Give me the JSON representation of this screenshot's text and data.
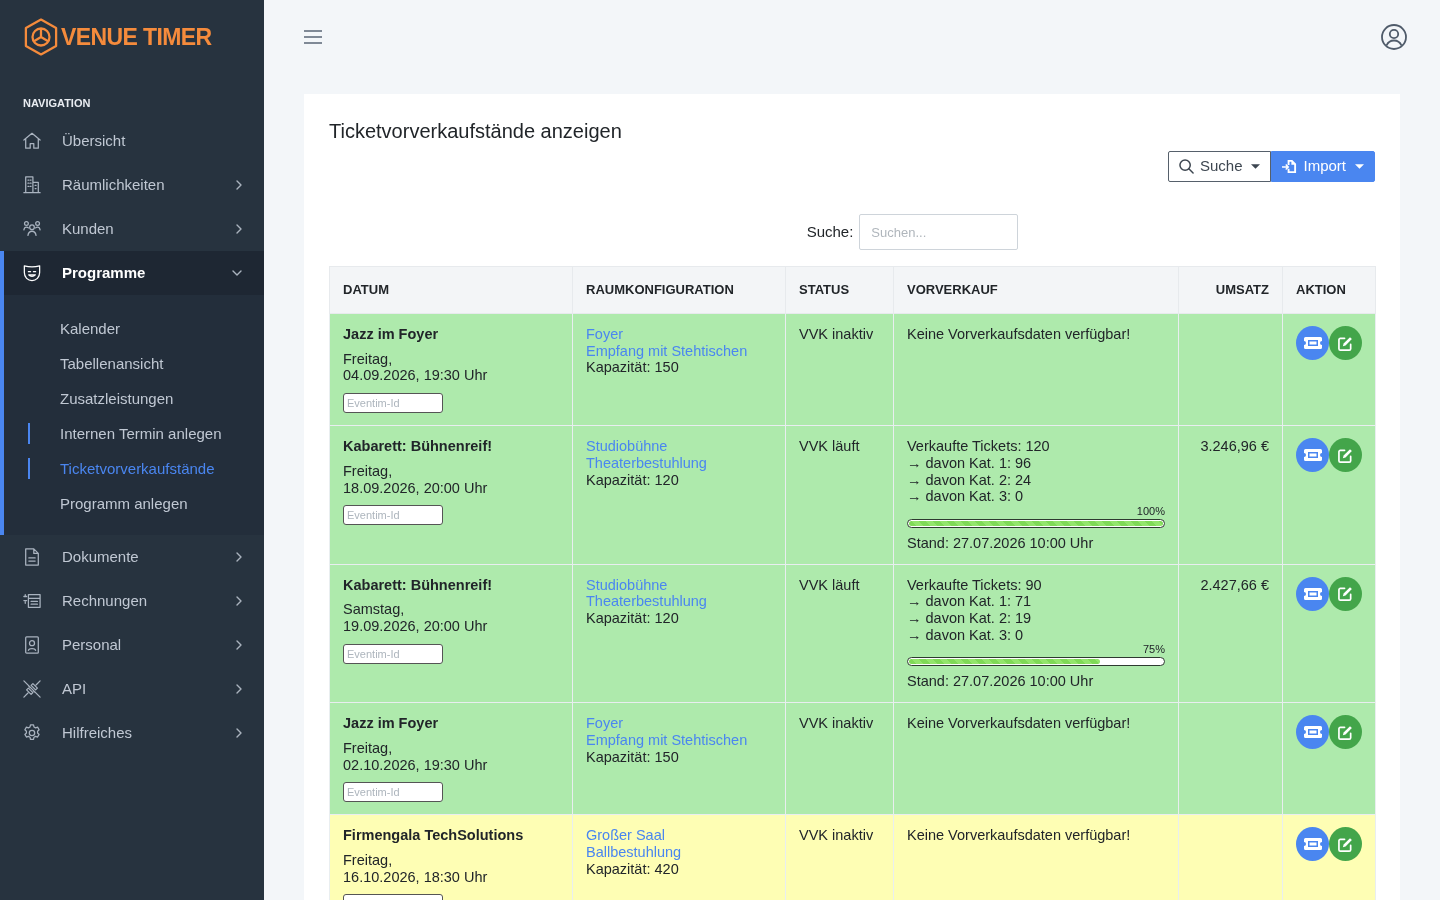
{
  "logo": {
    "text": "VENUE TIMER"
  },
  "sidebar": {
    "heading": "NAVIGATION",
    "items": [
      {
        "kind": "link",
        "label": "Übersicht"
      },
      {
        "kind": "group",
        "label": "Räumlichkeiten",
        "expanded": false
      },
      {
        "kind": "group",
        "label": "Kunden",
        "expanded": false
      },
      {
        "kind": "group",
        "label": "Programme",
        "expanded": true,
        "children": [
          {
            "label": "Kalender",
            "selected": false,
            "hovered": false
          },
          {
            "label": "Tabellenansicht",
            "selected": false,
            "hovered": false
          },
          {
            "label": "Zusatzleistungen",
            "selected": false,
            "hovered": false
          },
          {
            "label": "Internen Termin anlegen",
            "selected": false,
            "hovered": true
          },
          {
            "label": "Ticketvorverkaufstände",
            "selected": true,
            "hovered": false
          },
          {
            "label": "Programm anlegen",
            "selected": false,
            "hovered": false
          }
        ]
      },
      {
        "kind": "group",
        "label": "Dokumente",
        "expanded": false
      },
      {
        "kind": "group",
        "label": "Rechnungen",
        "expanded": false
      },
      {
        "kind": "group",
        "label": "Personal",
        "expanded": false
      },
      {
        "kind": "group",
        "label": "API",
        "expanded": false
      },
      {
        "kind": "group",
        "label": "Hilfreiches",
        "expanded": false
      }
    ]
  },
  "page": {
    "title": "Ticketvorverkaufstände anzeigen",
    "buttons": [
      {
        "kind": "outline",
        "label": "Suche"
      },
      {
        "kind": "primary",
        "label": "Import"
      }
    ],
    "search": {
      "label": "Suche:",
      "placeholder": "Suchen..."
    }
  },
  "table": {
    "columns": [
      "DATUM",
      "RAUMKONFIGURATION",
      "STATUS",
      "VORVERKAUF",
      "UMSATZ",
      "AKTION"
    ],
    "rows": [
      {
        "color": "#aeeaac",
        "title": "Jazz im Foyer",
        "weekday": "Freitag,",
        "datetime": "04.09.2026, 19:30 Uhr",
        "eventim_placeholder": "Eventim-Id",
        "venue": "Foyer",
        "setup": "Empfang mit Stehtischen",
        "capacity": "Kapazität: 150",
        "status": "VVK inaktiv",
        "presale": {
          "kind": "none",
          "text": "Keine Vorverkaufsdaten verfügbar!"
        }
      },
      {
        "color": "#aeeaac",
        "title": "Kabarett: Bühnenreif!",
        "weekday": "Freitag,",
        "datetime": "18.09.2026, 20:00 Uhr",
        "eventim_placeholder": "Eventim-Id",
        "venue": "Studiobühne",
        "setup": "Theaterbestuhlung",
        "capacity": "Kapazität: 120",
        "status": "VVK läuft",
        "presale": {
          "kind": "sales",
          "sold": "Verkaufte Tickets: 120",
          "categories": [
            "→ davon Kat. 1: 96",
            "→ davon Kat. 2: 24",
            "→ davon Kat. 3: 0"
          ],
          "percent": "100%",
          "level": 1,
          "as_of": "Stand: 27.07.2026 10:00 Uhr"
        },
        "revenue": "3.246,96 €"
      },
      {
        "color": "#aeeaac",
        "title": "Kabarett: Bühnenreif!",
        "weekday": "Samstag,",
        "datetime": "19.09.2026, 20:00 Uhr",
        "eventim_placeholder": "Eventim-Id",
        "venue": "Studiobühne",
        "setup": "Theaterbestuhlung",
        "capacity": "Kapazität: 120",
        "status": "VVK läuft",
        "presale": {
          "kind": "sales",
          "sold": "Verkaufte Tickets: 90",
          "categories": [
            "→ davon Kat. 1: 71",
            "→ davon Kat. 2: 19",
            "→ davon Kat. 3: 0"
          ],
          "percent": "75%",
          "level": 0.75,
          "as_of": "Stand: 27.07.2026 10:00 Uhr"
        },
        "revenue": "2.427,66 €"
      },
      {
        "color": "#aeeaac",
        "title": "Jazz im Foyer",
        "weekday": "Freitag,",
        "datetime": "02.10.2026, 19:30 Uhr",
        "eventim_placeholder": "Eventim-Id",
        "venue": "Foyer",
        "setup": "Empfang mit Stehtischen",
        "capacity": "Kapazität: 150",
        "status": "VVK inaktiv",
        "presale": {
          "kind": "none",
          "text": "Keine Vorverkaufsdaten verfügbar!"
        }
      },
      {
        "color": "#fefeb4",
        "title": "Firmengala TechSolutions",
        "weekday": "Freitag,",
        "datetime": "16.10.2026, 18:30 Uhr",
        "venue": "Großer Saal",
        "setup": "Ballbestuhlung",
        "capacity": "Kapazität: 420",
        "status": "VVK inaktiv",
        "presale": {
          "kind": "none",
          "text": "Keine Vorverkaufsdaten verfügbar!"
        }
      }
    ]
  }
}
